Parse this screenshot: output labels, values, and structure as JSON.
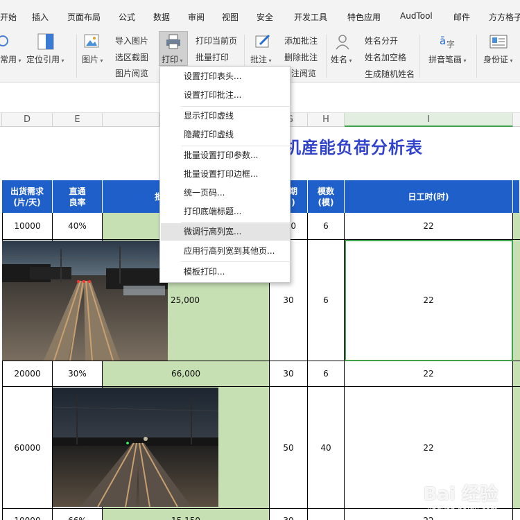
{
  "tabs": [
    "开始",
    "插入",
    "页面布局",
    "公式",
    "数据",
    "审阅",
    "视图",
    "安全",
    "开发工具",
    "特色应用",
    "AudTool",
    "邮件",
    "方方格子"
  ],
  "ribbon": {
    "normal_label": "常用",
    "position_ref_label": "定位引用",
    "picture_label": "图片",
    "import_picture": "导入图片",
    "region_screenshot": "选区截图",
    "picture_browse": "图片阅览",
    "print_label": "打印",
    "print_current_page": "打印当前页",
    "batch_print": "批量打印",
    "comment_label": "批注",
    "add_comment": "添加批注",
    "delete_comment": "删除批注",
    "comment_browse": "注阅览",
    "name_label": "姓名",
    "split_name": "姓名分开",
    "name_add_space": "姓名加空格",
    "random_name": "生成随机姓名",
    "pinyin_label": "拼音笔画",
    "id_card_label": "身份证"
  },
  "menu": {
    "items": [
      "设置打印表头...",
      "设置打印批注...",
      "显示打印虚线",
      "隐藏打印虚线",
      "批量设置打印参数...",
      "批量设置打印边框...",
      "统一页码...",
      "打印底端标题...",
      "微调行高列宽...",
      "应用行高列宽到其他页...",
      "模板打印..."
    ],
    "highlighted_index": 8
  },
  "columns": [
    "D",
    "E",
    "G",
    "H",
    "I"
  ],
  "sheet": {
    "title": "机産能负荷分析表",
    "headers": {
      "demand": "出货需求\n(片/天)",
      "yield": "直通\n良率",
      "partial_left": "批",
      "period": "期\n)",
      "molds": "模数\n(模)",
      "daily_hours": "日工时(时)"
    },
    "rows": [
      {
        "demand": "10000",
        "yield": "40%",
        "batch": "",
        "period": "0",
        "molds": "6",
        "hours": "22"
      },
      {
        "demand": "",
        "yield": "",
        "batch": "25,000",
        "period": "30",
        "molds": "6",
        "hours": "22"
      },
      {
        "demand": "20000",
        "yield": "30%",
        "batch": "66,000",
        "period": "30",
        "molds": "6",
        "hours": "22"
      },
      {
        "demand": "60000",
        "yield": "",
        "batch": "",
        "period": "50",
        "molds": "40",
        "hours": "22"
      },
      {
        "demand": "10000",
        "yield": "66%",
        "batch": "15,150",
        "period": "30",
        "molds": "",
        "hours": "22"
      }
    ]
  },
  "watermark": {
    "brand": "Bai 经验",
    "url": "jingyan.baidu.com"
  },
  "colors": {
    "header_blue": "#1f5fc9",
    "green_cell": "#c6e0b4",
    "title_blue": "#3344cc",
    "selection_green": "#3fa34d"
  }
}
